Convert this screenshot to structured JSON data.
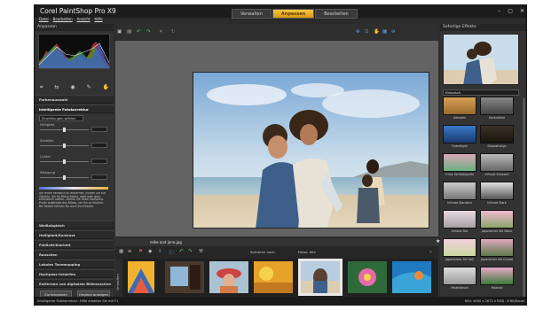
{
  "app": {
    "title": "Corel PaintShop Pro X9"
  },
  "menu": [
    "Datei",
    "Bearbeiten",
    "Ansicht",
    "Hilfe"
  ],
  "tabs": [
    "Verwalten",
    "Anpassen",
    "Bearbeiten"
  ],
  "active_tab": "Anpassen",
  "left_panel": {
    "title": "Anpassen",
    "sections": {
      "farbe": "Farbenauswahl",
      "intelligent": "Intelligente Fotokorrektur",
      "weissabgleich": "Weißabgleich",
      "helligkeit": "Helligkeit/Kontrast",
      "fuelllicht": "Fülllicht/Klarheit",
      "rauschen": "Rauschen",
      "lokal": "Lokales Tonemapping",
      "hochpass": "Hochpass-Schärfen",
      "entfernen": "Entfernen von digitalem Bildrauschen"
    },
    "preset_dropdown": "Einstellungen wählen",
    "sliders": [
      "Helligkeit",
      "Schatten",
      "Lichter",
      "Sättigung"
    ],
    "hint": "Um einen Farbstich zu entfernen, klicken Sie auf Objekte, die im Bild schwarz, weiß oder grau erscheinen sollten. Ziehen Sie einen Sampling-Punkt außerhalb des Bildes, um ihn zu löschen. Bei Bedarf können Sie auch ihn fixieren.",
    "buttons": {
      "reset": "Zurücksetzen",
      "show_original": "Original anzeigen"
    }
  },
  "toolbar_icons": [
    "save-icon",
    "print-icon",
    "undo-icon",
    "redo-icon",
    "delete-icon",
    "zoom-icon",
    "hand-icon",
    "fit-icon"
  ],
  "photo": {
    "filename": "mike and jane.jpg",
    "rating": "★★★★★"
  },
  "filmstrip": {
    "label": "Verwalten",
    "sort_label": "Sortieren nach",
    "filter_label": "Fotos: Alle"
  },
  "right_panel": {
    "title": "Sofortige Effekte",
    "category": "Klassisch",
    "effects": [
      "Altmalen",
      "Konkretiere",
      "Cyanotypie",
      "Diapositivtyp",
      "Frühe Farbfotografie",
      "Infrarot Schwach",
      "Infrarot Standard",
      "Infrarot Stark",
      "Infrarot Rot",
      "Japanischer Stil Natur",
      "Japanischer Stil Hell",
      "Japanischer Stil Dunkel",
      "Pastelldruck",
      "Polaroid"
    ]
  },
  "status": {
    "left": "Intelligente Fotokorrektur: Hilfe erhalten Sie mit F1",
    "right": "Bild: 4000 x 2672 x RGB - 8 Bit/Kanal"
  },
  "colors": {
    "accent": "#e8aa20",
    "panel": "#333333",
    "canvas": "#636363",
    "titlebar": "#1c1c1c"
  }
}
